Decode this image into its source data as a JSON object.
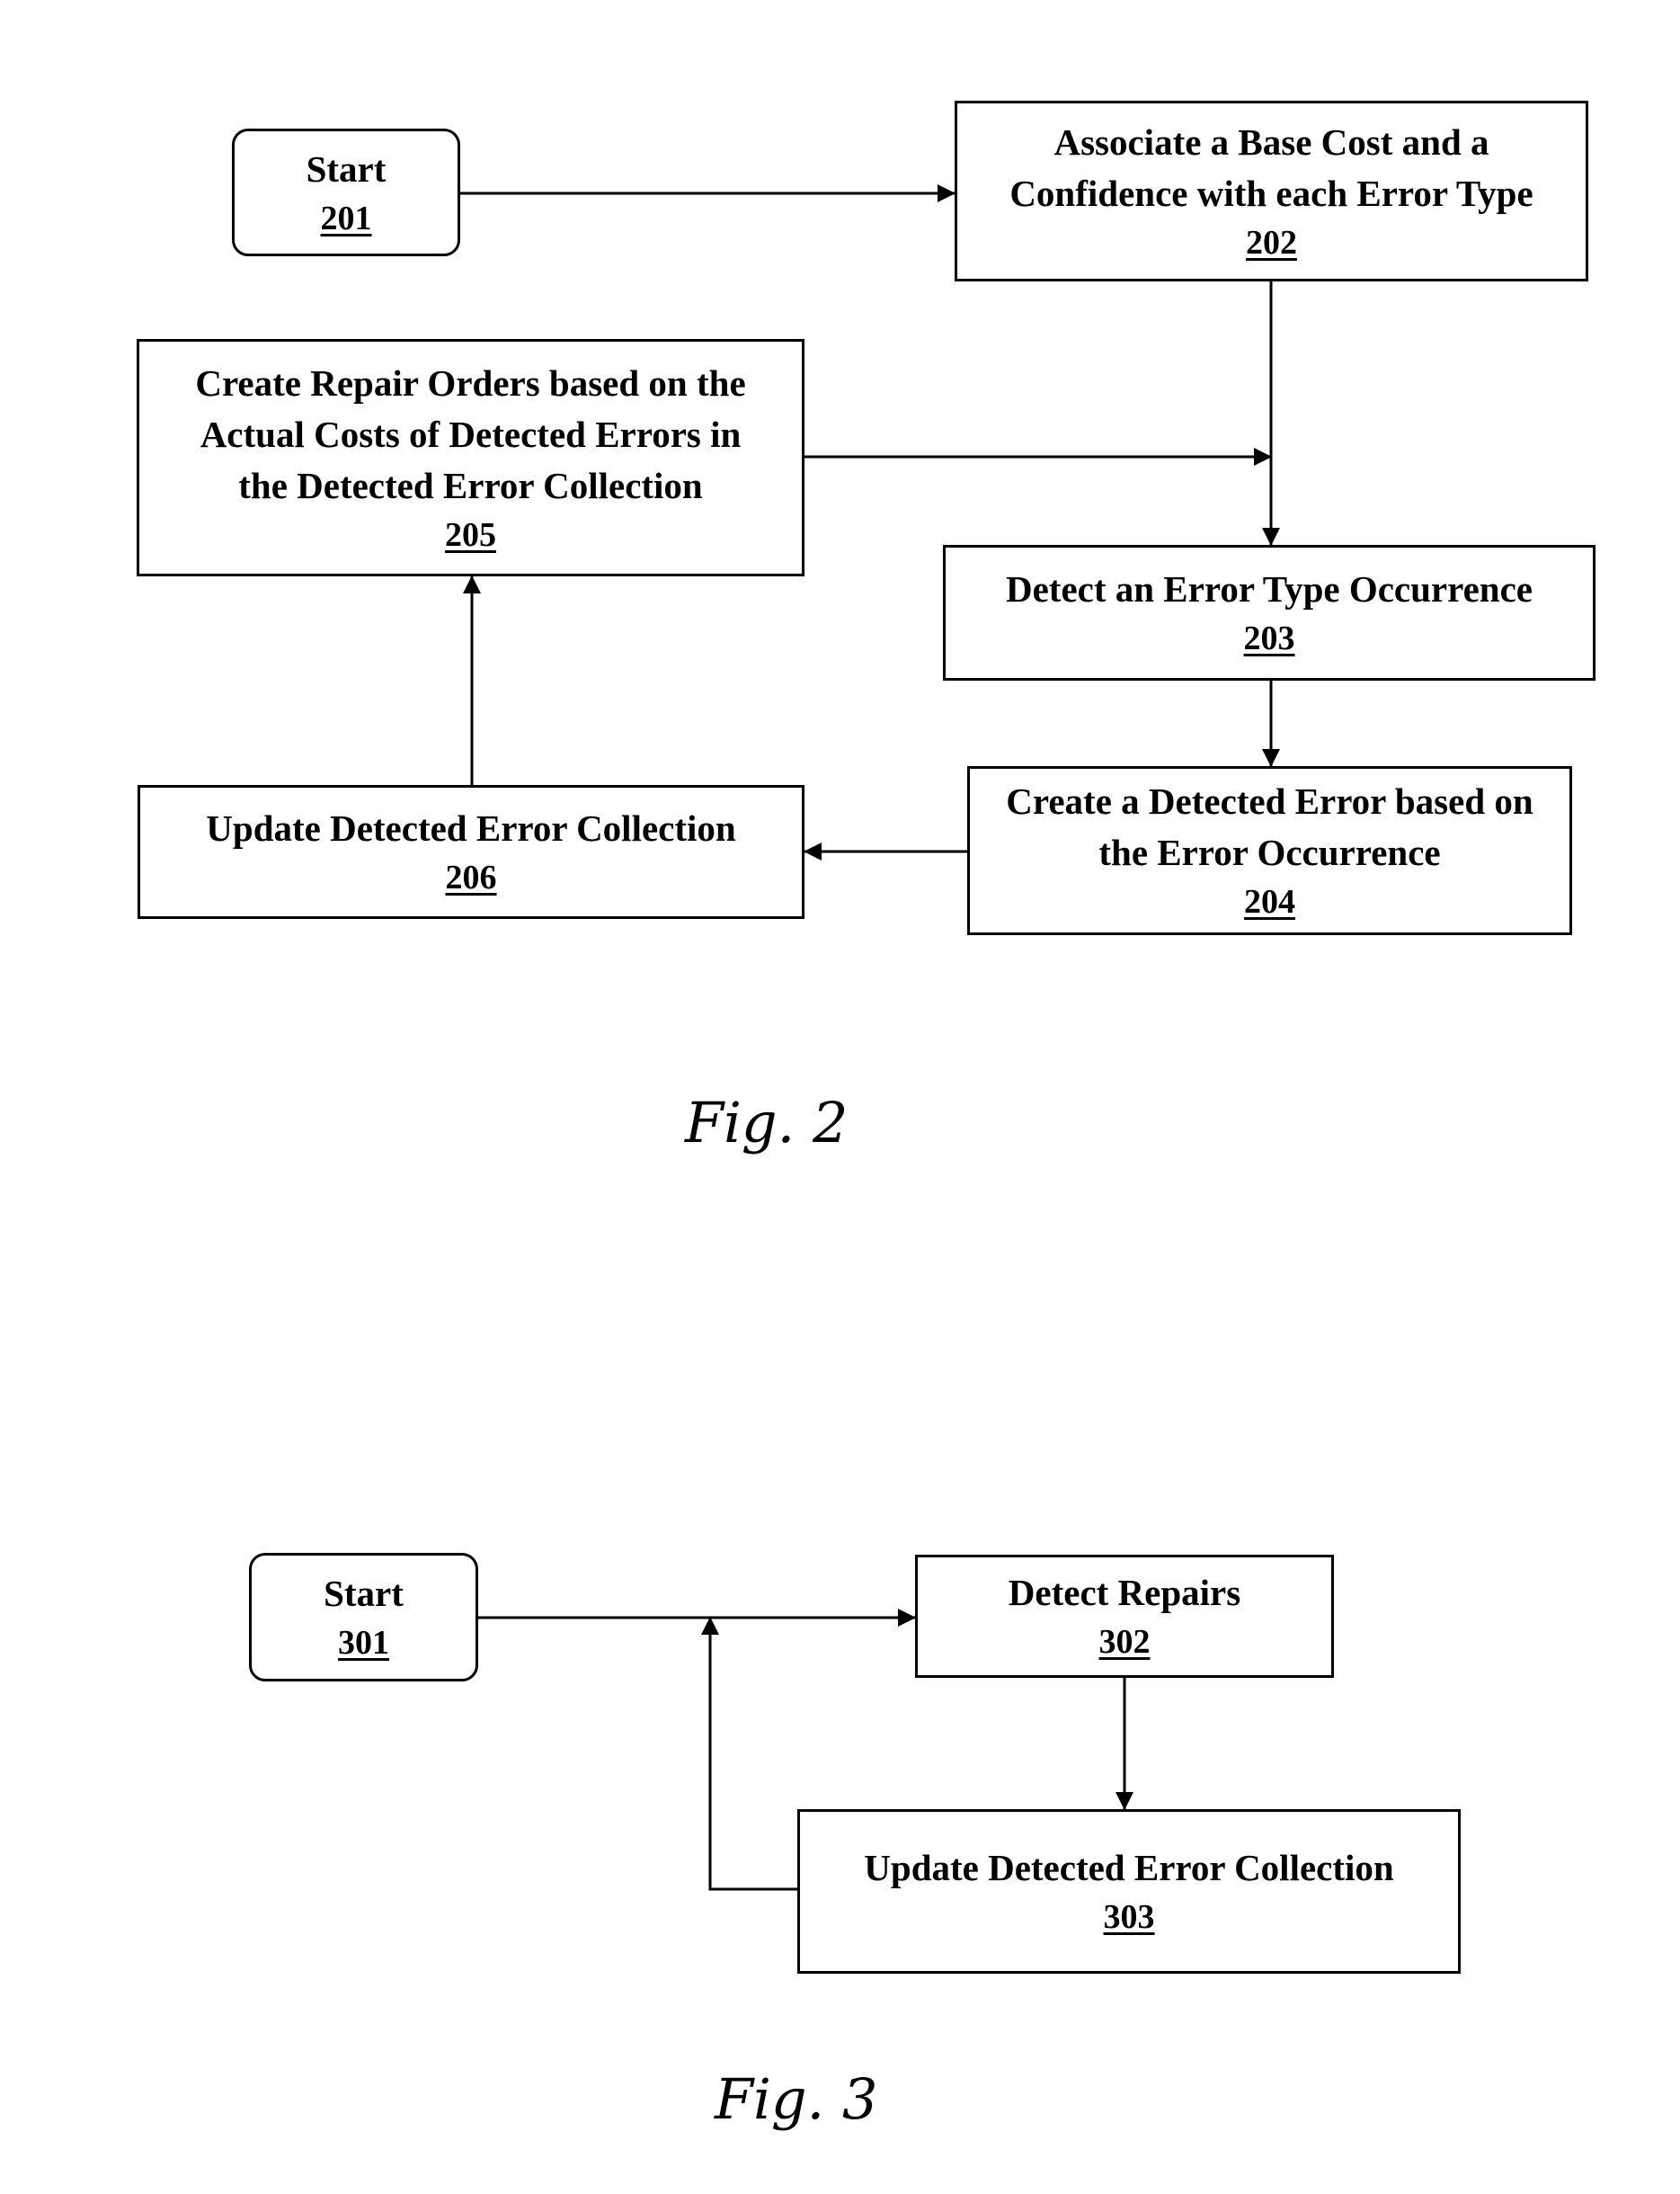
{
  "figures": [
    {
      "label": "Fig. 2",
      "nodes": [
        {
          "id": "201",
          "lines": [
            "Start"
          ],
          "ref": "201",
          "shape": "rounded"
        },
        {
          "id": "202",
          "lines": [
            "Associate a Base Cost and a",
            "Confidence with each Error Type"
          ],
          "ref": "202",
          "shape": "rect"
        },
        {
          "id": "203",
          "lines": [
            "Detect an Error Type Occurrence"
          ],
          "ref": "203",
          "shape": "rect"
        },
        {
          "id": "204",
          "lines": [
            "Create a Detected Error based on",
            "the Error Occurrence"
          ],
          "ref": "204",
          "shape": "rect"
        },
        {
          "id": "205",
          "lines": [
            "Create Repair Orders based on the",
            "Actual Costs of Detected Errors in",
            "the Detected Error Collection"
          ],
          "ref": "205",
          "shape": "rect"
        },
        {
          "id": "206",
          "lines": [
            "Update Detected Error Collection"
          ],
          "ref": "206",
          "shape": "rect"
        }
      ],
      "edges": [
        {
          "from": "201",
          "to": "202"
        },
        {
          "from": "202",
          "to": "203"
        },
        {
          "from": "203",
          "to": "204"
        },
        {
          "from": "204",
          "to": "206"
        },
        {
          "from": "206",
          "to": "205"
        },
        {
          "from": "205",
          "to": "203"
        }
      ]
    },
    {
      "label": "Fig. 3",
      "nodes": [
        {
          "id": "301",
          "lines": [
            "Start"
          ],
          "ref": "301",
          "shape": "rounded"
        },
        {
          "id": "302",
          "lines": [
            "Detect Repairs"
          ],
          "ref": "302",
          "shape": "rect"
        },
        {
          "id": "303",
          "lines": [
            "Update Detected Error Collection"
          ],
          "ref": "303",
          "shape": "rect"
        }
      ],
      "edges": [
        {
          "from": "301",
          "to": "302"
        },
        {
          "from": "302",
          "to": "303"
        },
        {
          "from": "303",
          "to": "302"
        }
      ]
    }
  ]
}
